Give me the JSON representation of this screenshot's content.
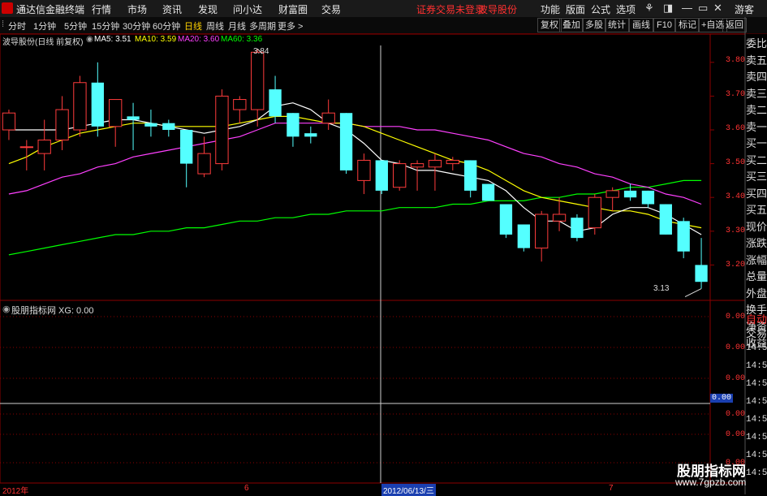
{
  "app": {
    "name": "通达信金融终端"
  },
  "menu": [
    "行情",
    "市场",
    "资讯",
    "发现",
    "问小达",
    "财富圈",
    "交易"
  ],
  "status": {
    "trade_login": "证券交易未登录",
    "stock_name": "波导股份"
  },
  "right_menu": [
    "功能",
    "版面",
    "公式",
    "选项"
  ],
  "window_controls": [
    "⚘",
    "◨",
    "—",
    "▭",
    "✕"
  ],
  "account": "游客",
  "periods": [
    "分时",
    "1分钟",
    "5分钟",
    "15分钟",
    "30分钟",
    "60分钟",
    "日线",
    "周线",
    "月线",
    "多周期",
    "更多 >"
  ],
  "active_period": "日线",
  "toolbar_right": [
    "复权",
    "叠加",
    "多股",
    "统计",
    "画线",
    "F10",
    "标记",
    "+自选",
    "返回"
  ],
  "main_legend": {
    "title": "波导股份(日线 前复权)",
    "ma5": "MA5: 3.51",
    "ma10": "MA10: 3.59",
    "ma20": "MA20: 3.60",
    "ma60": "MA60: 3.36"
  },
  "colors": {
    "up": "#ff3c3c",
    "down": "#54ffff",
    "ma5": "#ffffff",
    "ma10": "#ffff00",
    "ma20": "#ff40ff",
    "ma60": "#00ff00",
    "grid": "#8b0000",
    "axis_text": "#ff3333"
  },
  "price_axis": [
    "3.80",
    "3.70",
    "3.60",
    "3.50",
    "3.40",
    "3.30",
    "3.20"
  ],
  "annotations": {
    "high": "3.84",
    "low": "3.13"
  },
  "side_labels": [
    "委比",
    "卖五",
    "卖四",
    "卖三",
    "卖二",
    "卖一",
    "买一",
    "买二",
    "买三",
    "买四",
    "买五",
    "现价",
    "涨跌",
    "涨幅",
    "总量",
    "外盘",
    "换手",
    "净资",
    "收益"
  ],
  "side_labels_red": [
    "自动",
    "交易"
  ],
  "times": [
    "14:56",
    "14:56",
    "14:56",
    "14:56",
    "14:56",
    "14:56",
    "14:56",
    "14:56"
  ],
  "indicator": {
    "title": "股朋指标网 XG: 0.00",
    "axis": [
      "0.00",
      "0.00",
      "0.00",
      "0.00",
      "0.00",
      "0.00"
    ],
    "current": "0.00"
  },
  "x_axis": {
    "start": "2012年",
    "month6": "6",
    "crosshair_date": "2012/06/13/三",
    "month7": "7"
  },
  "watermark": {
    "name": "股朋指标网",
    "url": "www.7gpzb.com"
  },
  "chart_data": {
    "type": "candlestick",
    "ylim": [
      3.1,
      3.85
    ],
    "candles": [
      [
        3.6,
        3.65,
        3.66,
        3.57
      ],
      [
        3.55,
        3.55,
        3.57,
        3.48
      ],
      [
        3.53,
        3.57,
        3.63,
        3.48
      ],
      [
        3.57,
        3.66,
        3.7,
        3.54
      ],
      [
        3.6,
        3.74,
        3.76,
        3.58
      ],
      [
        3.74,
        3.61,
        3.8,
        3.58
      ],
      [
        3.61,
        3.69,
        3.69,
        3.55
      ],
      [
        3.64,
        3.63,
        3.68,
        3.54
      ],
      [
        3.62,
        3.61,
        3.66,
        3.58
      ],
      [
        3.62,
        3.6,
        3.63,
        3.58
      ],
      [
        3.6,
        3.5,
        3.6,
        3.43
      ],
      [
        3.47,
        3.53,
        3.58,
        3.46
      ],
      [
        3.5,
        3.7,
        3.72,
        3.48
      ],
      [
        3.66,
        3.69,
        3.7,
        3.62
      ],
      [
        3.66,
        3.83,
        3.84,
        3.61
      ],
      [
        3.72,
        3.64,
        3.76,
        3.62
      ],
      [
        3.65,
        3.58,
        3.65,
        3.55
      ],
      [
        3.59,
        3.58,
        3.61,
        3.56
      ],
      [
        3.62,
        3.65,
        3.69,
        3.6
      ],
      [
        3.65,
        3.48,
        3.65,
        3.47
      ],
      [
        3.45,
        3.51,
        3.53,
        3.41
      ],
      [
        3.51,
        3.42,
        3.51,
        3.41
      ],
      [
        3.43,
        3.5,
        3.51,
        3.42
      ],
      [
        3.49,
        3.5,
        3.51,
        3.42
      ],
      [
        3.49,
        3.51,
        3.53,
        3.42
      ],
      [
        3.5,
        3.51,
        3.52,
        3.48
      ],
      [
        3.51,
        3.42,
        3.51,
        3.4
      ],
      [
        3.44,
        3.39,
        3.44,
        3.39
      ],
      [
        3.38,
        3.29,
        3.38,
        3.28
      ],
      [
        3.32,
        3.25,
        3.32,
        3.24
      ],
      [
        3.25,
        3.35,
        3.36,
        3.21
      ],
      [
        3.33,
        3.35,
        3.4,
        3.3
      ],
      [
        3.34,
        3.28,
        3.35,
        3.27
      ],
      [
        3.31,
        3.4,
        3.41,
        3.29
      ],
      [
        3.4,
        3.42,
        3.43,
        3.36
      ],
      [
        3.42,
        3.4,
        3.44,
        3.39
      ],
      [
        3.42,
        3.38,
        3.42,
        3.37
      ],
      [
        3.38,
        3.29,
        3.38,
        3.29
      ],
      [
        3.33,
        3.24,
        3.34,
        3.22
      ],
      [
        3.2,
        3.15,
        3.28,
        3.13
      ]
    ],
    "ma5": [
      3.6,
      3.6,
      3.6,
      3.6,
      3.61,
      3.62,
      3.63,
      3.63,
      3.62,
      3.61,
      3.6,
      3.59,
      3.6,
      3.61,
      3.63,
      3.67,
      3.68,
      3.66,
      3.62,
      3.6,
      3.56,
      3.51,
      3.5,
      3.48,
      3.48,
      3.47,
      3.46,
      3.45,
      3.42,
      3.37,
      3.33,
      3.33,
      3.3,
      3.31,
      3.35,
      3.37,
      3.37,
      3.35,
      3.32,
      3.29
    ],
    "ma10": [
      3.5,
      3.52,
      3.55,
      3.57,
      3.59,
      3.6,
      3.61,
      3.62,
      3.62,
      3.61,
      3.61,
      3.61,
      3.61,
      3.62,
      3.63,
      3.64,
      3.64,
      3.63,
      3.62,
      3.62,
      3.61,
      3.59,
      3.57,
      3.55,
      3.53,
      3.51,
      3.5,
      3.48,
      3.45,
      3.42,
      3.4,
      3.39,
      3.38,
      3.37,
      3.36,
      3.36,
      3.35,
      3.33,
      3.32,
      3.31
    ],
    "ma20": [
      3.41,
      3.42,
      3.44,
      3.46,
      3.47,
      3.49,
      3.5,
      3.52,
      3.53,
      3.54,
      3.55,
      3.56,
      3.57,
      3.58,
      3.6,
      3.62,
      3.62,
      3.62,
      3.62,
      3.62,
      3.61,
      3.61,
      3.61,
      3.6,
      3.6,
      3.59,
      3.58,
      3.57,
      3.55,
      3.53,
      3.52,
      3.5,
      3.49,
      3.47,
      3.46,
      3.44,
      3.43,
      3.41,
      3.4,
      3.38
    ],
    "ma60": [
      3.23,
      3.24,
      3.25,
      3.26,
      3.27,
      3.28,
      3.29,
      3.29,
      3.3,
      3.3,
      3.31,
      3.31,
      3.32,
      3.33,
      3.33,
      3.34,
      3.34,
      3.35,
      3.35,
      3.36,
      3.36,
      3.36,
      3.37,
      3.37,
      3.37,
      3.38,
      3.38,
      3.39,
      3.39,
      3.39,
      3.4,
      3.4,
      3.41,
      3.41,
      3.42,
      3.43,
      3.43,
      3.44,
      3.45,
      3.45
    ]
  }
}
